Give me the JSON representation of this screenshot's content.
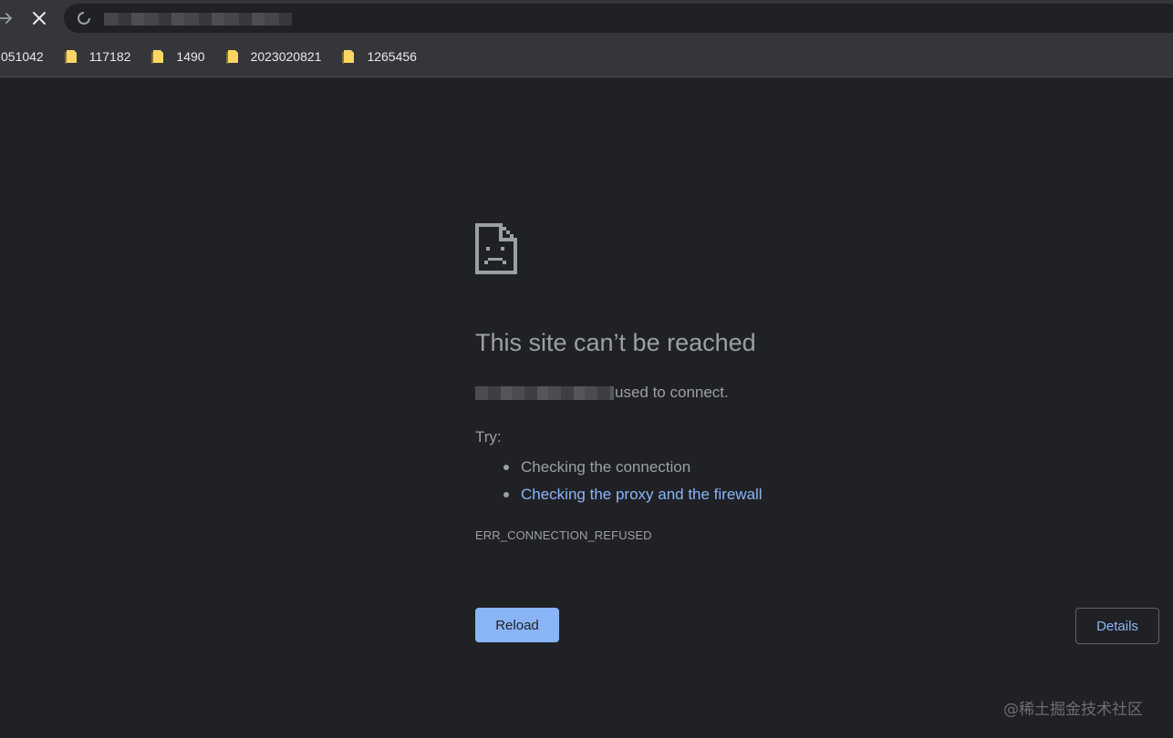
{
  "browser": {
    "bookmarks": [
      {
        "label": "051042",
        "icon": "none"
      },
      {
        "label": "117182",
        "icon": "folder-icon"
      },
      {
        "label": "1490",
        "icon": "folder-icon"
      },
      {
        "label": "2023020821",
        "icon": "folder-icon"
      },
      {
        "label": "1265456",
        "icon": "folder-icon"
      }
    ],
    "colors": {
      "toolbar": "#35363a",
      "background": "#202124",
      "folder": "#fdd663"
    }
  },
  "error_page": {
    "title": "This site can’t be reached",
    "description_suffix": "used to connect.",
    "try_label": "Try:",
    "suggestions": [
      "Checking the connection",
      "Checking the proxy and the firewall"
    ],
    "error_code": "ERR_CONNECTION_REFUSED",
    "reload_label": "Reload",
    "details_label": "Details",
    "colors": {
      "accent": "#8ab4f8",
      "text": "#9aa0a6"
    }
  },
  "watermark": {
    "text": "@稀土掘金技术社区"
  }
}
